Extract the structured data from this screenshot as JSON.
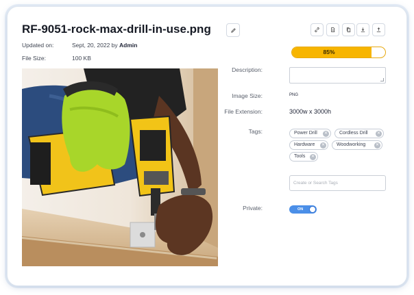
{
  "file": {
    "title": "RF-9051-rock-max-drill-in-use.png",
    "edit_icon": "pencil-icon"
  },
  "toolbar": {
    "buttons": [
      {
        "name": "link-button",
        "icon": "link-icon"
      },
      {
        "name": "file-button",
        "icon": "file-icon"
      },
      {
        "name": "copy-button",
        "icon": "copy-icon"
      },
      {
        "name": "download-button",
        "icon": "download-icon"
      },
      {
        "name": "upload-button",
        "icon": "upload-icon"
      }
    ]
  },
  "meta": {
    "updated_label": "Updated on:",
    "updated_date": "Sept, 20, 2022 by",
    "updated_by": "Admin",
    "size_label": "File Size:",
    "size_value": "100 KB"
  },
  "image": {
    "subject": "power drill in use"
  },
  "progress": {
    "label": "85%",
    "value": 0.85,
    "color": "#f7b500"
  },
  "form": {
    "description_label": "Description:",
    "description_value": "",
    "image_size_label": "Image Size:",
    "image_size_value": "PNG",
    "extension_label": "File Extension:",
    "extension_value": "3000w x 3000h",
    "tags_label": "Tags:",
    "tags": [
      "Power Drill",
      "Cordless Drill",
      "Hardware",
      "Woodworking",
      "Tools"
    ],
    "tag_input_placeholder": "Create or Search Tags",
    "private_label": "Private:",
    "private_toggle": "ON",
    "private_on": true,
    "toggle_color": "#4b8fe8"
  }
}
